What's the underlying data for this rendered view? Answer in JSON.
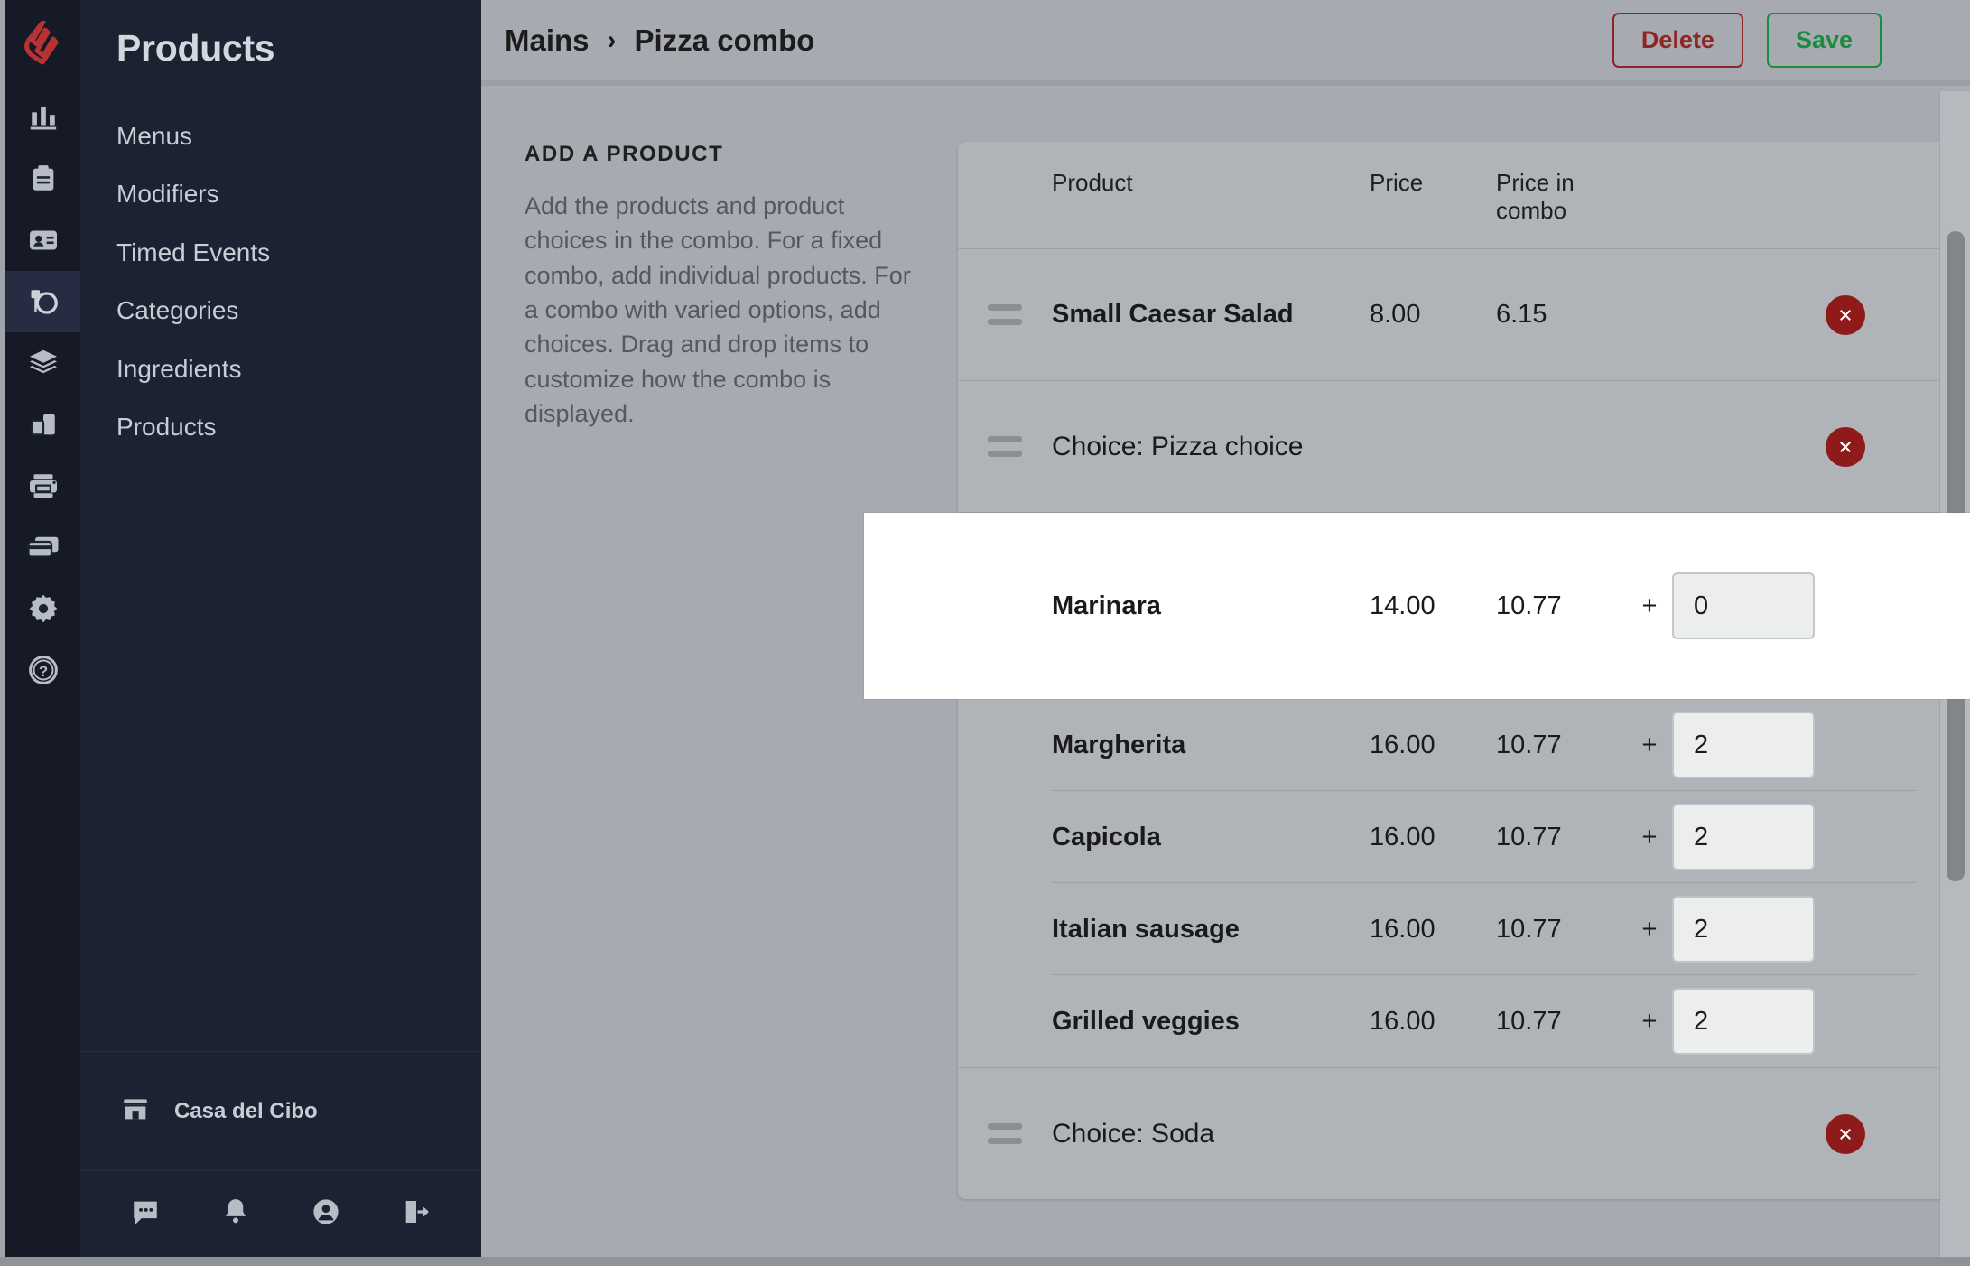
{
  "brand": {
    "logo": "lightspeed-flame-logo",
    "accent": "#b83232"
  },
  "rail": {
    "items": [
      {
        "icon": "reports-bar-chart-icon",
        "active": false
      },
      {
        "icon": "clipboard-orders-icon",
        "active": false
      },
      {
        "icon": "customer-card-icon",
        "active": false
      },
      {
        "icon": "menu-dining-icon",
        "active": true
      },
      {
        "icon": "layers-stack-icon",
        "active": false
      },
      {
        "icon": "devices-icon",
        "active": false
      },
      {
        "icon": "printer-icon",
        "active": false
      },
      {
        "icon": "payment-cards-icon",
        "active": false
      },
      {
        "icon": "gear-settings-icon",
        "active": false
      },
      {
        "icon": "help-question-icon",
        "active": false
      }
    ]
  },
  "sidebar": {
    "title": "Products",
    "items": [
      {
        "label": "Menus"
      },
      {
        "label": "Modifiers"
      },
      {
        "label": "Timed Events"
      },
      {
        "label": "Categories"
      },
      {
        "label": "Ingredients"
      },
      {
        "label": "Products"
      }
    ],
    "store": {
      "icon": "storefront-icon",
      "name": "Casa del Cibo"
    },
    "bottom_icons": [
      {
        "icon": "chat-message-icon"
      },
      {
        "icon": "bell-notification-icon"
      },
      {
        "icon": "user-account-icon"
      },
      {
        "icon": "logout-icon"
      }
    ]
  },
  "topbar": {
    "breadcrumb": {
      "parent": "Mains",
      "separator": "›",
      "current": "Pizza combo"
    },
    "delete_label": "Delete",
    "save_label": "Save",
    "delete_color": "#8f2525",
    "save_color": "#198c3e"
  },
  "left_panel": {
    "section_label": "ADD A PRODUCT",
    "description": "Add the products and product choices in the combo. For a fixed combo, add individual products. For a combo with varied options, add choices. Drag and drop items to customize how the combo is displayed."
  },
  "table": {
    "headers": {
      "product": "Product",
      "price": "Price",
      "price_in_combo": "Price in combo"
    },
    "rows": [
      {
        "type": "product",
        "name": "Small Caesar Salad",
        "price": "8.00",
        "price_in_combo": "6.15",
        "handle_icon": "drag-handle-icon",
        "delete_icon": "remove-circle-icon"
      },
      {
        "type": "choice",
        "name": "Choice: Pizza choice",
        "handle_icon": "drag-handle-icon",
        "delete_icon": "remove-circle-icon",
        "children": [
          {
            "name": "Marinara",
            "price": "14.00",
            "price_in_combo": "10.77",
            "plus": "+",
            "qty": "0",
            "highlighted": true
          },
          {
            "name": "Margherita",
            "price": "16.00",
            "price_in_combo": "10.77",
            "plus": "+",
            "qty": "2",
            "highlighted": false
          },
          {
            "name": "Capicola",
            "price": "16.00",
            "price_in_combo": "10.77",
            "plus": "+",
            "qty": "2",
            "highlighted": false
          },
          {
            "name": "Italian sausage",
            "price": "16.00",
            "price_in_combo": "10.77",
            "plus": "+",
            "qty": "2",
            "highlighted": false
          },
          {
            "name": "Grilled veggies",
            "price": "16.00",
            "price_in_combo": "10.77",
            "plus": "+",
            "qty": "2",
            "highlighted": false
          }
        ]
      },
      {
        "type": "choice",
        "name": "Choice: Soda",
        "handle_icon": "drag-handle-icon",
        "delete_icon": "remove-circle-icon",
        "children": []
      }
    ]
  },
  "scrollbar": {
    "name": "vertical-scrollbar"
  }
}
